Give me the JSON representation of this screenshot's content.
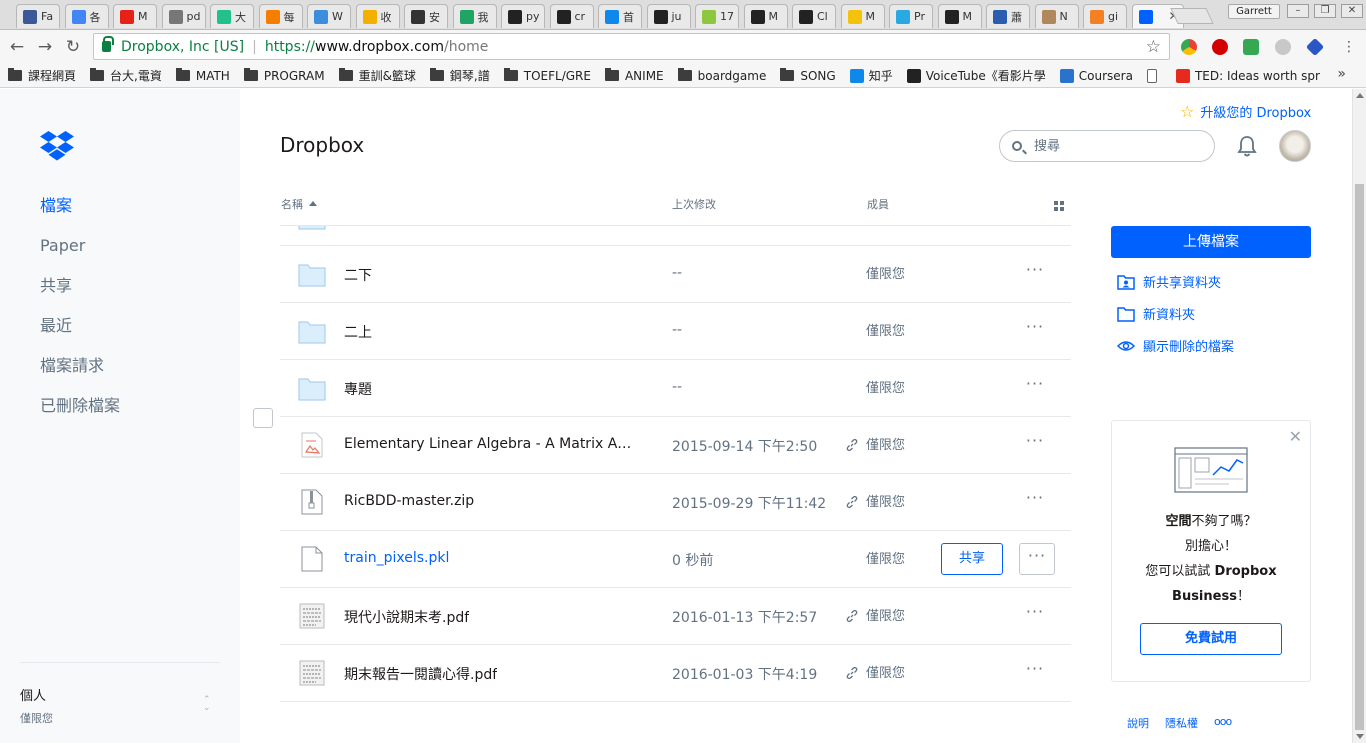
{
  "browser": {
    "tabs": [
      {
        "label": "Fa",
        "color": "#3b5998"
      },
      {
        "label": "各",
        "color": "#4285f4"
      },
      {
        "label": "M",
        "color": "#e62117"
      },
      {
        "label": "pd",
        "color": "#777777"
      },
      {
        "label": "大",
        "color": "#22c08a"
      },
      {
        "label": "每",
        "color": "#f57d00"
      },
      {
        "label": "W",
        "color": "#3c8dde"
      },
      {
        "label": "收",
        "color": "#f2b100"
      },
      {
        "label": "安",
        "color": "#333333"
      },
      {
        "label": "我",
        "color": "#1fa463"
      },
      {
        "label": "py",
        "color": "#222222"
      },
      {
        "label": "cr",
        "color": "#222222"
      },
      {
        "label": "首",
        "color": "#0f88eb"
      },
      {
        "label": "ju",
        "color": "#222222"
      },
      {
        "label": "17",
        "color": "#8dc63f"
      },
      {
        "label": "M",
        "color": "#222222"
      },
      {
        "label": "Cl",
        "color": "#222222"
      },
      {
        "label": "M",
        "color": "#f4c20d"
      },
      {
        "label": "Pr",
        "color": "#29a9e1"
      },
      {
        "label": "M",
        "color": "#222222"
      },
      {
        "label": "蕭",
        "color": "#2a5db0"
      },
      {
        "label": "N",
        "color": "#b0885b"
      },
      {
        "label": "gi",
        "color": "#f48024"
      },
      {
        "label": "",
        "color": "#0061fe",
        "active": true
      }
    ],
    "profile_name": "Garrett",
    "address": {
      "secure_label": "Dropbox, Inc [US]",
      "scheme": "https://",
      "host": "www.dropbox.com",
      "path": "/home"
    },
    "bookmarks": [
      {
        "label": "課程網頁",
        "type": "folder"
      },
      {
        "label": "台大,電資",
        "type": "folder"
      },
      {
        "label": "MATH",
        "type": "folder"
      },
      {
        "label": "PROGRAM",
        "type": "folder"
      },
      {
        "label": "重訓&籃球",
        "type": "folder"
      },
      {
        "label": "鋼琴,譜",
        "type": "folder"
      },
      {
        "label": "TOEFL/GRE",
        "type": "folder"
      },
      {
        "label": "ANIME",
        "type": "folder"
      },
      {
        "label": "boardgame",
        "type": "folder"
      },
      {
        "label": "SONG",
        "type": "folder"
      },
      {
        "label": "知乎",
        "type": "site",
        "color": "#0f88eb"
      },
      {
        "label": "VoiceTube《看影片學",
        "type": "site",
        "color": "#222222"
      },
      {
        "label": "Coursera",
        "type": "site",
        "color": "#2a73cc"
      },
      {
        "label": "",
        "type": "page"
      },
      {
        "label": "TED: Ideas worth spr",
        "type": "site",
        "color": "#e62b1e"
      }
    ],
    "bookmarks_more": "»"
  },
  "sidebar": {
    "items": [
      {
        "label": "檔案",
        "active": true
      },
      {
        "label": "Paper"
      },
      {
        "label": "共享"
      },
      {
        "label": "最近"
      },
      {
        "label": "檔案請求"
      },
      {
        "label": "已刪除檔案"
      }
    ],
    "account_name": "個人",
    "account_sub": "僅限您"
  },
  "header": {
    "upgrade_label": "升級您的 Dropbox",
    "title": "Dropbox",
    "search_placeholder": "搜尋"
  },
  "table": {
    "col_name": "名稱",
    "col_modified": "上次修改",
    "col_members": "成員",
    "rows": [
      {
        "name": "二下",
        "type": "folder",
        "modified": "--",
        "members": "僅限您",
        "shared_link": false
      },
      {
        "name": "二上",
        "type": "folder",
        "modified": "--",
        "members": "僅限您",
        "shared_link": false
      },
      {
        "name": "專題",
        "type": "folder",
        "modified": "--",
        "members": "僅限您",
        "shared_link": false
      },
      {
        "name": "Elementary Linear Algebra - A Matrix Ap...",
        "type": "pdf",
        "modified": "2015-09-14 下午2:50",
        "members": "僅限您",
        "shared_link": true
      },
      {
        "name": "RicBDD-master.zip",
        "type": "zip",
        "modified": "2015-09-29 下午11:42",
        "members": "僅限您",
        "shared_link": true
      },
      {
        "name": "train_pixels.pkl",
        "type": "file",
        "modified": "0 秒前",
        "members": "僅限您",
        "shared_link": false,
        "hovered": true,
        "share_label": "共享"
      },
      {
        "name": "現代小說期末考.pdf",
        "type": "doc",
        "modified": "2016-01-13 下午2:57",
        "members": "僅限您",
        "shared_link": true
      },
      {
        "name": "期末報告一閱讀心得.pdf",
        "type": "doc",
        "modified": "2016-01-03 下午4:19",
        "members": "僅限您",
        "shared_link": true
      }
    ],
    "more_label": "···"
  },
  "right_panel": {
    "upload_label": "上傳檔案",
    "new_shared_folder": "新共享資料夾",
    "new_folder": "新資料夾",
    "show_deleted": "顯示刪除的檔案",
    "promo": {
      "line1_bold": "空間",
      "line1_rest": "不夠了嗎？",
      "line2": "別擔心！",
      "line3_prefix": "您可以試試 ",
      "line3_bold": "Dropbox",
      "line4_bold": "Business",
      "line4_rest": "！",
      "cta": "免費試用"
    },
    "footer": {
      "help": "說明",
      "privacy": "隱私權",
      "more": "ooo"
    }
  },
  "colors": {
    "accent": "#0061fe",
    "secure_green": "#0b8043",
    "muted": "#637282"
  }
}
